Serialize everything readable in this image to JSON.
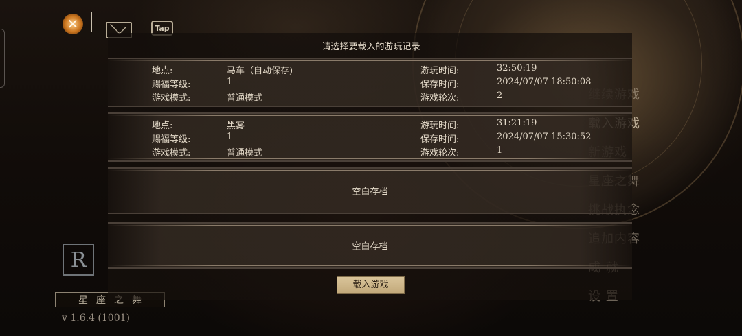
{
  "dialog": {
    "title": "请选择要载入的游玩记录",
    "load_button": "载入游戏"
  },
  "labels": {
    "location": "地点:",
    "blessing_level": "赐福等级:",
    "game_mode": "游戏模式:",
    "play_time": "游玩时间:",
    "save_time": "保存时间:",
    "round": "游戏轮次:"
  },
  "slots": [
    {
      "location": "马车（自动保存)",
      "blessing_level": "1",
      "game_mode": "普通模式",
      "play_time": "32:50:19",
      "save_time": "2024/07/07 18:50:08",
      "round": "2"
    },
    {
      "location": "黑雾",
      "blessing_level": "1",
      "game_mode": "普通模式",
      "play_time": "31:21:19",
      "save_time": "2024/07/07 15:30:52",
      "round": "1"
    }
  ],
  "empty_slots": [
    "空白存档",
    "空白存档"
  ],
  "menu": [
    "继续游戏",
    "载入游戏",
    "新游戏",
    "星座之舞",
    "挑战执念",
    "追加内容",
    "成 就",
    "设 置"
  ],
  "top_icons": {
    "close": "close-icon",
    "mail": "mail-icon",
    "tap": "Tap"
  },
  "logo_letter": "R",
  "game_title": "星座之舞",
  "version": "v 1.6.4 (1001)"
}
